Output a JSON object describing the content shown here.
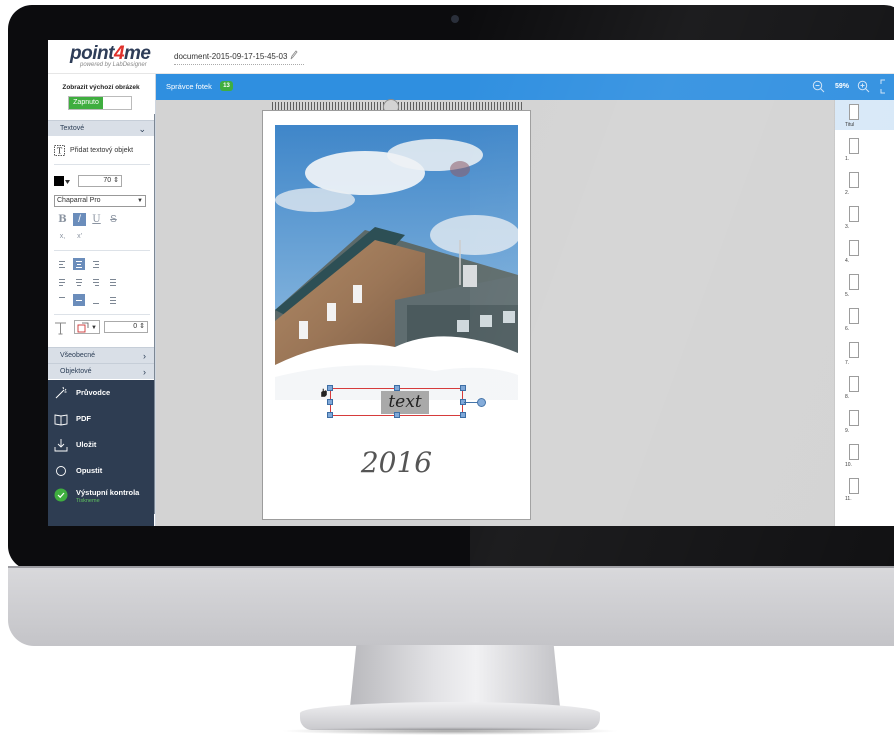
{
  "app": {
    "logo_main": "point",
    "logo_accent": "4",
    "logo_end": "me",
    "logo_sub": "powered by LabDesigner",
    "document_name": "document-2015-09-17-15-45-03"
  },
  "left_panel": {
    "toggle_title": "Zobrazit výchozí obrázek",
    "toggle_on_label": "Zapnuto",
    "section_text": "Textové",
    "add_text_label": "Přidat textový objekt",
    "font_size": "70",
    "font_name": "Chaparral Pro",
    "format": {
      "bold": "B",
      "italic": "/",
      "underline": "U",
      "strike": "S",
      "subscript": "x,",
      "superscript": "x'"
    },
    "rotation_value": "0",
    "section_general": "Všeobecné",
    "section_object": "Objektové",
    "text_color": "#000000"
  },
  "nav": {
    "items": [
      {
        "label": "Průvodce",
        "icon": "wand-icon"
      },
      {
        "label": "PDF",
        "icon": "book-icon"
      },
      {
        "label": "Uložit",
        "icon": "save-icon"
      },
      {
        "label": "Opustit",
        "icon": "exit-icon"
      },
      {
        "label": "Výstupní kontrola",
        "icon": "check-circle-icon",
        "sub": "Tiskneme"
      }
    ]
  },
  "toolbar": {
    "title": "Správce fotek",
    "photo_count": "13",
    "zoom_value": "59%"
  },
  "canvas": {
    "text_object": "text",
    "year": "2016"
  },
  "right_strip": {
    "labels": [
      "Titul",
      "1.",
      "2.",
      "3.",
      "4.",
      "5.",
      "6.",
      "7.",
      "8.",
      "9.",
      "10.",
      "11."
    ]
  },
  "colors": {
    "toolbar": "#2f8fe0",
    "nav_dark": "#2e3d52",
    "accent_green": "#3fae3f",
    "logo_red": "#e0322c"
  }
}
